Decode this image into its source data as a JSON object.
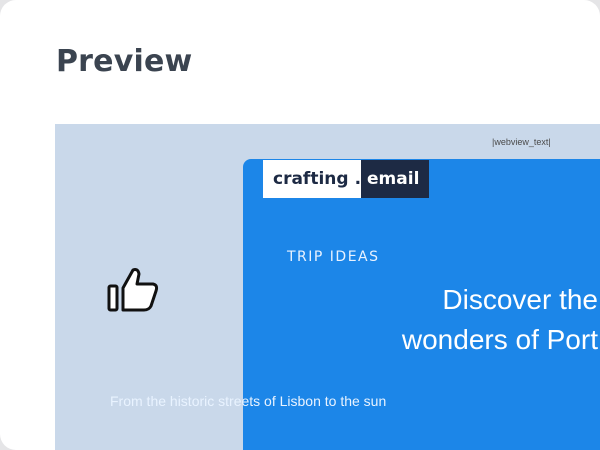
{
  "page": {
    "title": "Preview"
  },
  "preview": {
    "webview_text": "|webview_text|",
    "thumb_icon": "thumbs-up-icon",
    "email": {
      "logo_left": "crafting",
      "logo_dot": ".",
      "logo_right": "email",
      "kicker": "TRIP IDEAS",
      "headline_line1": "Discover the",
      "headline_line2": "wonders of Port",
      "subtext": "From the historic streets of Lisbon to the sun"
    }
  },
  "colors": {
    "preview_bg": "#c9d8ea",
    "email_bg": "#1c86e8",
    "logo_dark": "#1d2a44",
    "title_text": "#3b4450"
  }
}
